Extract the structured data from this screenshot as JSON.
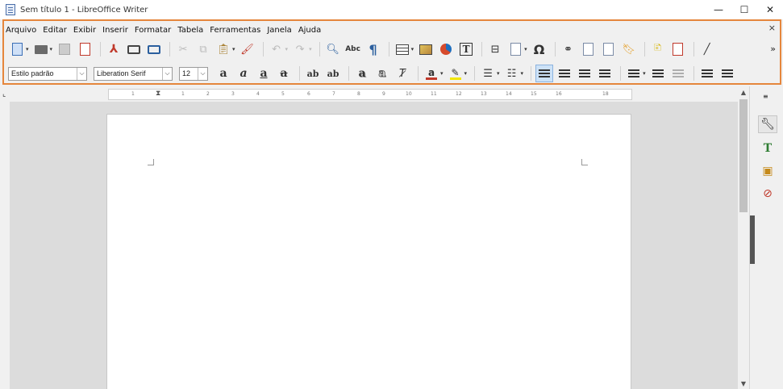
{
  "window": {
    "title": "Sem título 1 - LibreOffice Writer",
    "minimize": "—",
    "maximize": "☐",
    "close": "✕"
  },
  "menubar": {
    "items": [
      "Arquivo",
      "Editar",
      "Exibir",
      "Inserir",
      "Formatar",
      "Tabela",
      "Ferramentas",
      "Janela",
      "Ajuda"
    ],
    "close": "×"
  },
  "formatting": {
    "paragraph_style": "Estilo padrão",
    "font_name": "Liberation Serif",
    "font_size": "12",
    "dropdown_arrow": "⌵"
  },
  "toolbar": {
    "more": "»",
    "special_char": "Ω",
    "nonprint": "¶",
    "spelling": "Abc",
    "textbox": "T",
    "bold": "a",
    "italic": "a",
    "underline": "a",
    "strike": "a",
    "superscript": "ab",
    "subscript": "ab"
  },
  "ruler": {
    "marks": [
      "1",
      "1",
      "2",
      "3",
      "4",
      "5",
      "6",
      "7",
      "8",
      "9",
      "10",
      "11",
      "12",
      "13",
      "14",
      "15",
      "16",
      "18"
    ]
  },
  "sidebar": {
    "icons": [
      "properties-icon",
      "styles-icon",
      "gallery-icon",
      "navigator-icon"
    ]
  },
  "colors": {
    "accent_border": "#e5863c",
    "font_color": "#c0392b",
    "highlight_color": "#f1e600",
    "canvas": "#dcdcdc"
  }
}
